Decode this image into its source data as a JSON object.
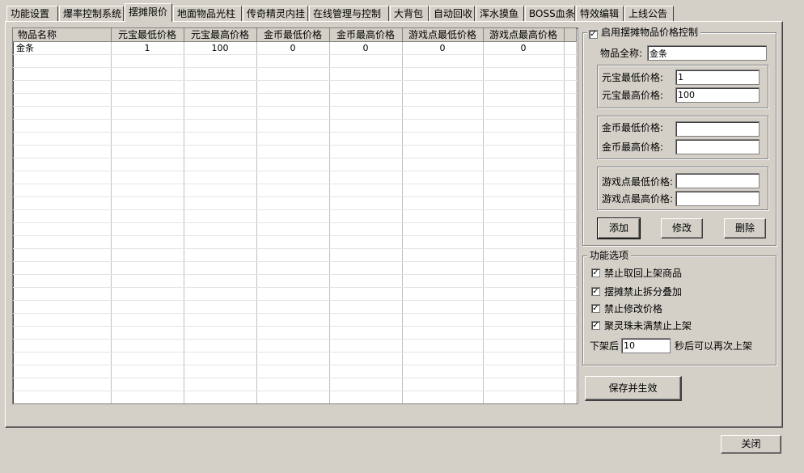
{
  "tabs": [
    "功能设置",
    "爆率控制系统",
    "摆摊限价",
    "地面物品光柱",
    "传奇精灵内挂",
    "在线管理与控制",
    "大背包",
    "自动回收",
    "浑水摸鱼",
    "BOSS血条",
    "特效编辑",
    "上线公告"
  ],
  "active_tab": "摆摊限价",
  "grid": {
    "columns": [
      "物品名称",
      "元宝最低价格",
      "元宝最高价格",
      "金币最低价格",
      "金币最高价格",
      "游戏点最低价格",
      "游戏点最高价格"
    ],
    "rows": [
      [
        "金条",
        "1",
        "100",
        "0",
        "0",
        "0",
        "0"
      ]
    ]
  },
  "price_control": {
    "enable_label": "启用摆摊物品价格控制",
    "enabled": true,
    "item_name_label": "物品全称:",
    "item_name_value": "金条",
    "yuanbao_min_label": "元宝最低价格:",
    "yuanbao_min_value": "1",
    "yuanbao_max_label": "元宝最高价格:",
    "yuanbao_max_value": "100",
    "gold_min_label": "金币最低价格:",
    "gold_min_value": "",
    "gold_max_label": "金币最高价格:",
    "gold_max_value": "",
    "gamepoint_min_label": "游戏点最低价格:",
    "gamepoint_min_value": "",
    "gamepoint_max_label": "游戏点最高价格:",
    "gamepoint_max_value": "",
    "add_label": "添加",
    "modify_label": "修改",
    "delete_label": "删除"
  },
  "options": {
    "title": "功能选项",
    "items": [
      {
        "label": "禁止取回上架商品",
        "checked": true
      },
      {
        "label": "摆摊禁止拆分叠加",
        "checked": true
      },
      {
        "label": "禁止修改价格",
        "checked": true
      },
      {
        "label": "聚灵珠未满禁止上架",
        "checked": true
      }
    ],
    "relist_prefix": "下架后",
    "relist_value": "10",
    "relist_suffix": "秒后可以再次上架"
  },
  "save_label": "保存并生效",
  "close_label": "关闭"
}
